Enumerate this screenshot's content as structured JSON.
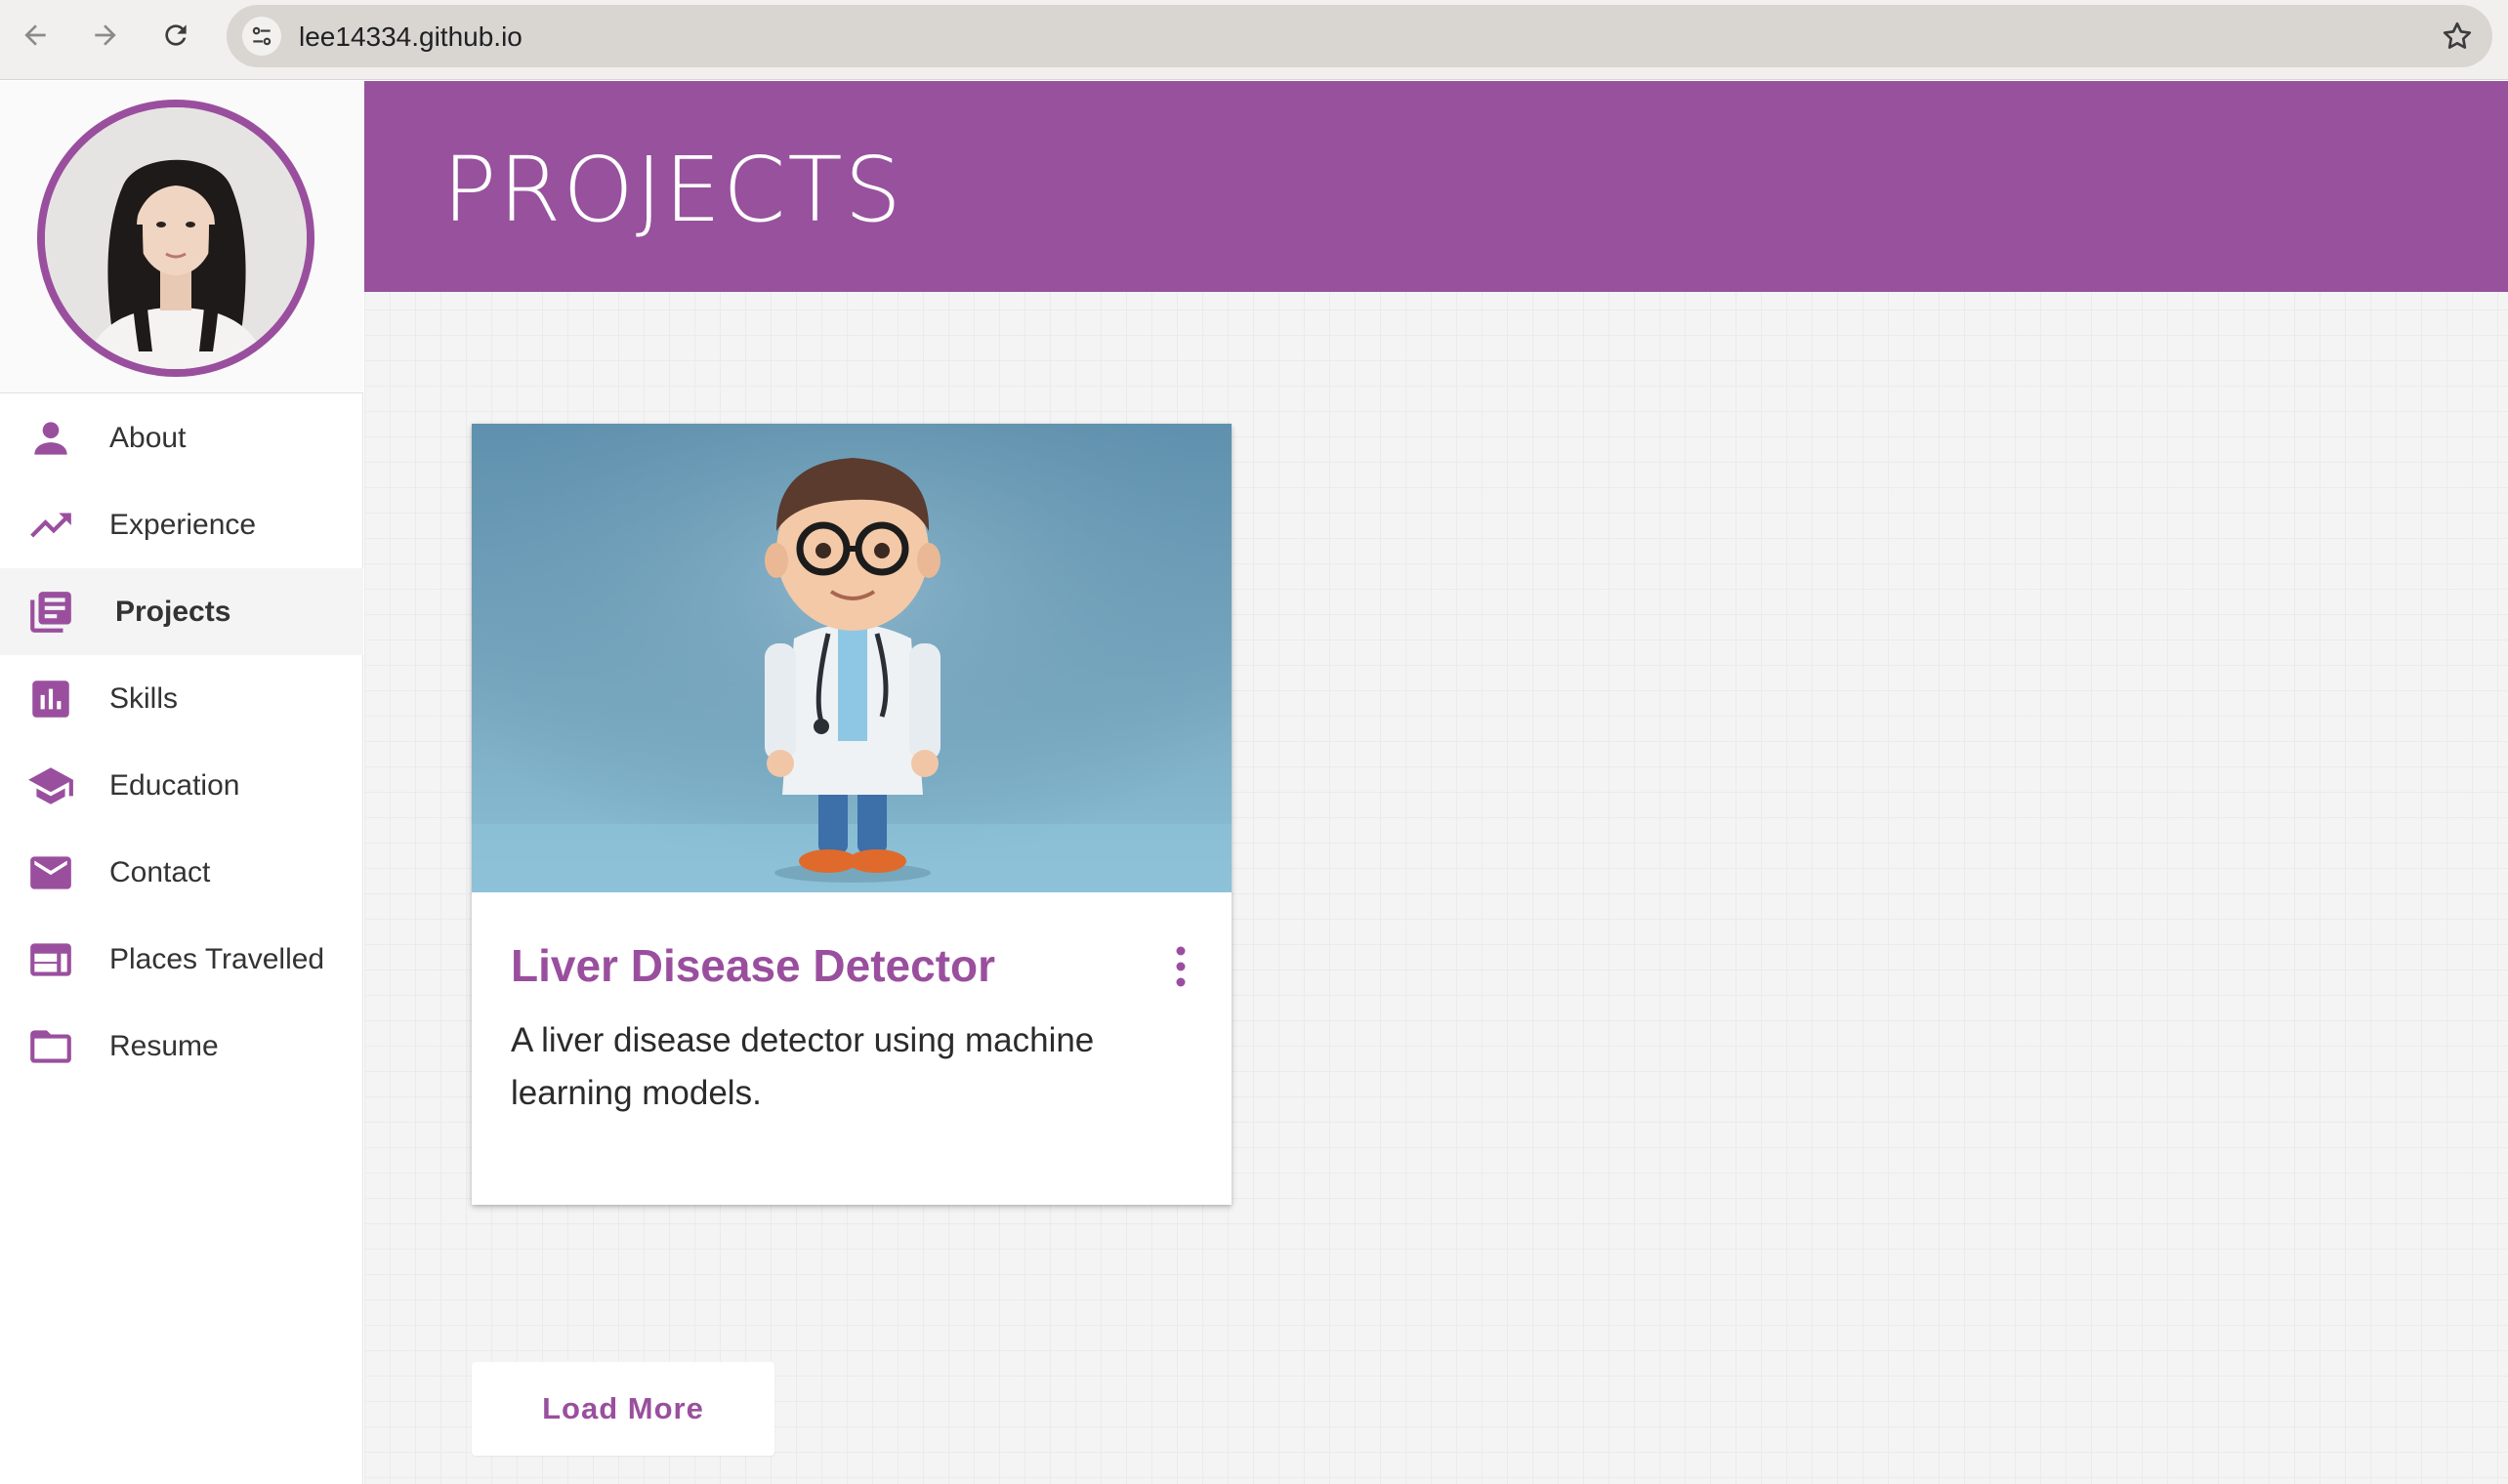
{
  "browser": {
    "url": "lee14334.github.io",
    "icons": {
      "back": "arrow-left-icon",
      "forward": "arrow-right-icon",
      "reload": "reload-icon",
      "site_info": "tune-icon",
      "bookmark": "star-outline-icon"
    }
  },
  "sidebar": {
    "avatar_alt": "profile-photo",
    "items": [
      {
        "label": "About",
        "icon": "person-icon",
        "active": false
      },
      {
        "label": "Experience",
        "icon": "trending-up-icon",
        "active": false
      },
      {
        "label": "Projects",
        "icon": "library-books-icon",
        "active": true
      },
      {
        "label": "Skills",
        "icon": "bar-chart-icon",
        "active": false
      },
      {
        "label": "Education",
        "icon": "school-icon",
        "active": false
      },
      {
        "label": "Contact",
        "icon": "email-icon",
        "active": false
      },
      {
        "label": "Places Travelled",
        "icon": "web-layout-icon",
        "active": false
      },
      {
        "label": "Resume",
        "icon": "folder-icon",
        "active": false
      }
    ]
  },
  "main": {
    "title": "PROJECTS",
    "projects": [
      {
        "title": "Liver Disease Detector",
        "description": "A liver disease detector using machine learning models.",
        "image": "doctor-character-illustration"
      }
    ],
    "load_more_label": "Load More"
  },
  "colors": {
    "accent": "#97519d",
    "accent_text": "#9a4f9e",
    "background": "#f4f4f4",
    "sidebar_active": "#f4f4f4"
  }
}
